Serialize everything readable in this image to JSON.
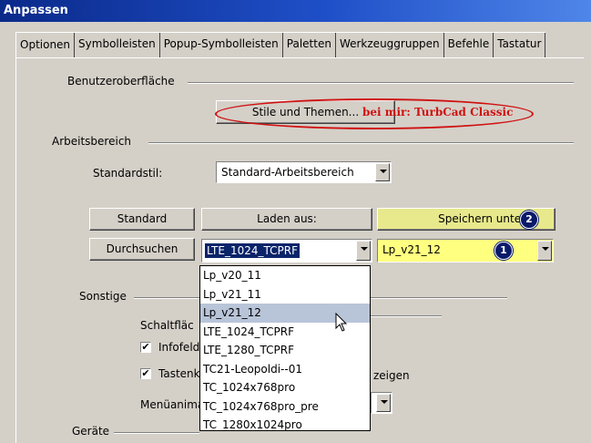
{
  "window": {
    "title": "Anpassen"
  },
  "tabs": [
    "Optionen",
    "Symbolleisten",
    "Popup-Symbolleisten",
    "Paletten",
    "Werkzeuggruppen",
    "Befehle",
    "Tastatur"
  ],
  "benutzer": {
    "group_label": "Benutzeroberfläche",
    "stile_button": "Stile und Themen...",
    "annotation": "bei mir: TurbCad Classic"
  },
  "arbeitsbereich": {
    "group_label": "Arbeitsbereich",
    "standardstil_label": "Standardstil:",
    "standardstil_value": "Standard-Arbeitsbereich",
    "standard_button": "Standard",
    "durchsuchen_button": "Durchsuchen",
    "laden_button": "Laden aus:",
    "laden_value": "LTE_1024_TCPRF",
    "speichern_button": "Speichern unter:",
    "speichern_value": "Lp_v21_12",
    "badge_1": "1",
    "badge_2": "2"
  },
  "dropdown": {
    "items": [
      "Lp_v20_11",
      "Lp_v21_11",
      "Lp_v21_12",
      "LTE_1024_TCPRF",
      "LTE_1280_TCPRF",
      "TC21-Leopoldi--01",
      "TC_1024x768pro",
      "TC_1024x768pro_pre",
      "TC_1280x1024pro"
    ],
    "selected_index": 2
  },
  "sonstige": {
    "group_label": "Sonstige",
    "schaltflaechen_label": "Schaltfläc",
    "infofelder_label": "Infofelde",
    "tastenk_label": "Tastenk",
    "tastenk_suffix": "zeigen",
    "menuanimation_label": "Menüanima",
    "infofelder_checked": "✔",
    "tastenk_checked": "✔"
  },
  "geraete": {
    "group_label": "Geräte"
  },
  "colors": {
    "title_start": "#0a2a8a",
    "title_end": "#4f86e8",
    "highlight_yellow": "#ffff80",
    "button_yellow": "#e8e88c",
    "annotation_red": "#d01010",
    "badge_blue": "#0a1a6a"
  }
}
